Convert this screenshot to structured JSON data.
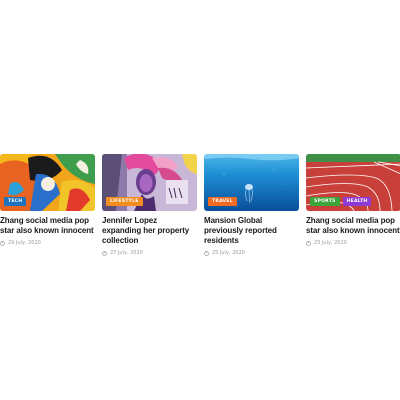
{
  "posts": [
    {
      "tags": [
        {
          "label": "TECH",
          "color": "#1e73be"
        }
      ],
      "title": "Zhang social media pop star also known innocent",
      "date": "29 July, 2020"
    },
    {
      "tags": [
        {
          "label": "LIFESTYLE",
          "color": "#f28c1e"
        }
      ],
      "title": "Jennifer Lopez expanding her property collection",
      "date": "27 July, 2020"
    },
    {
      "tags": [
        {
          "label": "TRAVEL",
          "color": "#f26a21"
        }
      ],
      "title": "Mansion Global previously reported residents",
      "date": "25 July, 2020"
    },
    {
      "tags": [
        {
          "label": "SPORTS",
          "color": "#3aa53a"
        },
        {
          "label": "HEALTH",
          "color": "#8e3bd6"
        }
      ],
      "title": "Zhang social media pop star also known innocent",
      "date": "23 July, 2020"
    }
  ]
}
